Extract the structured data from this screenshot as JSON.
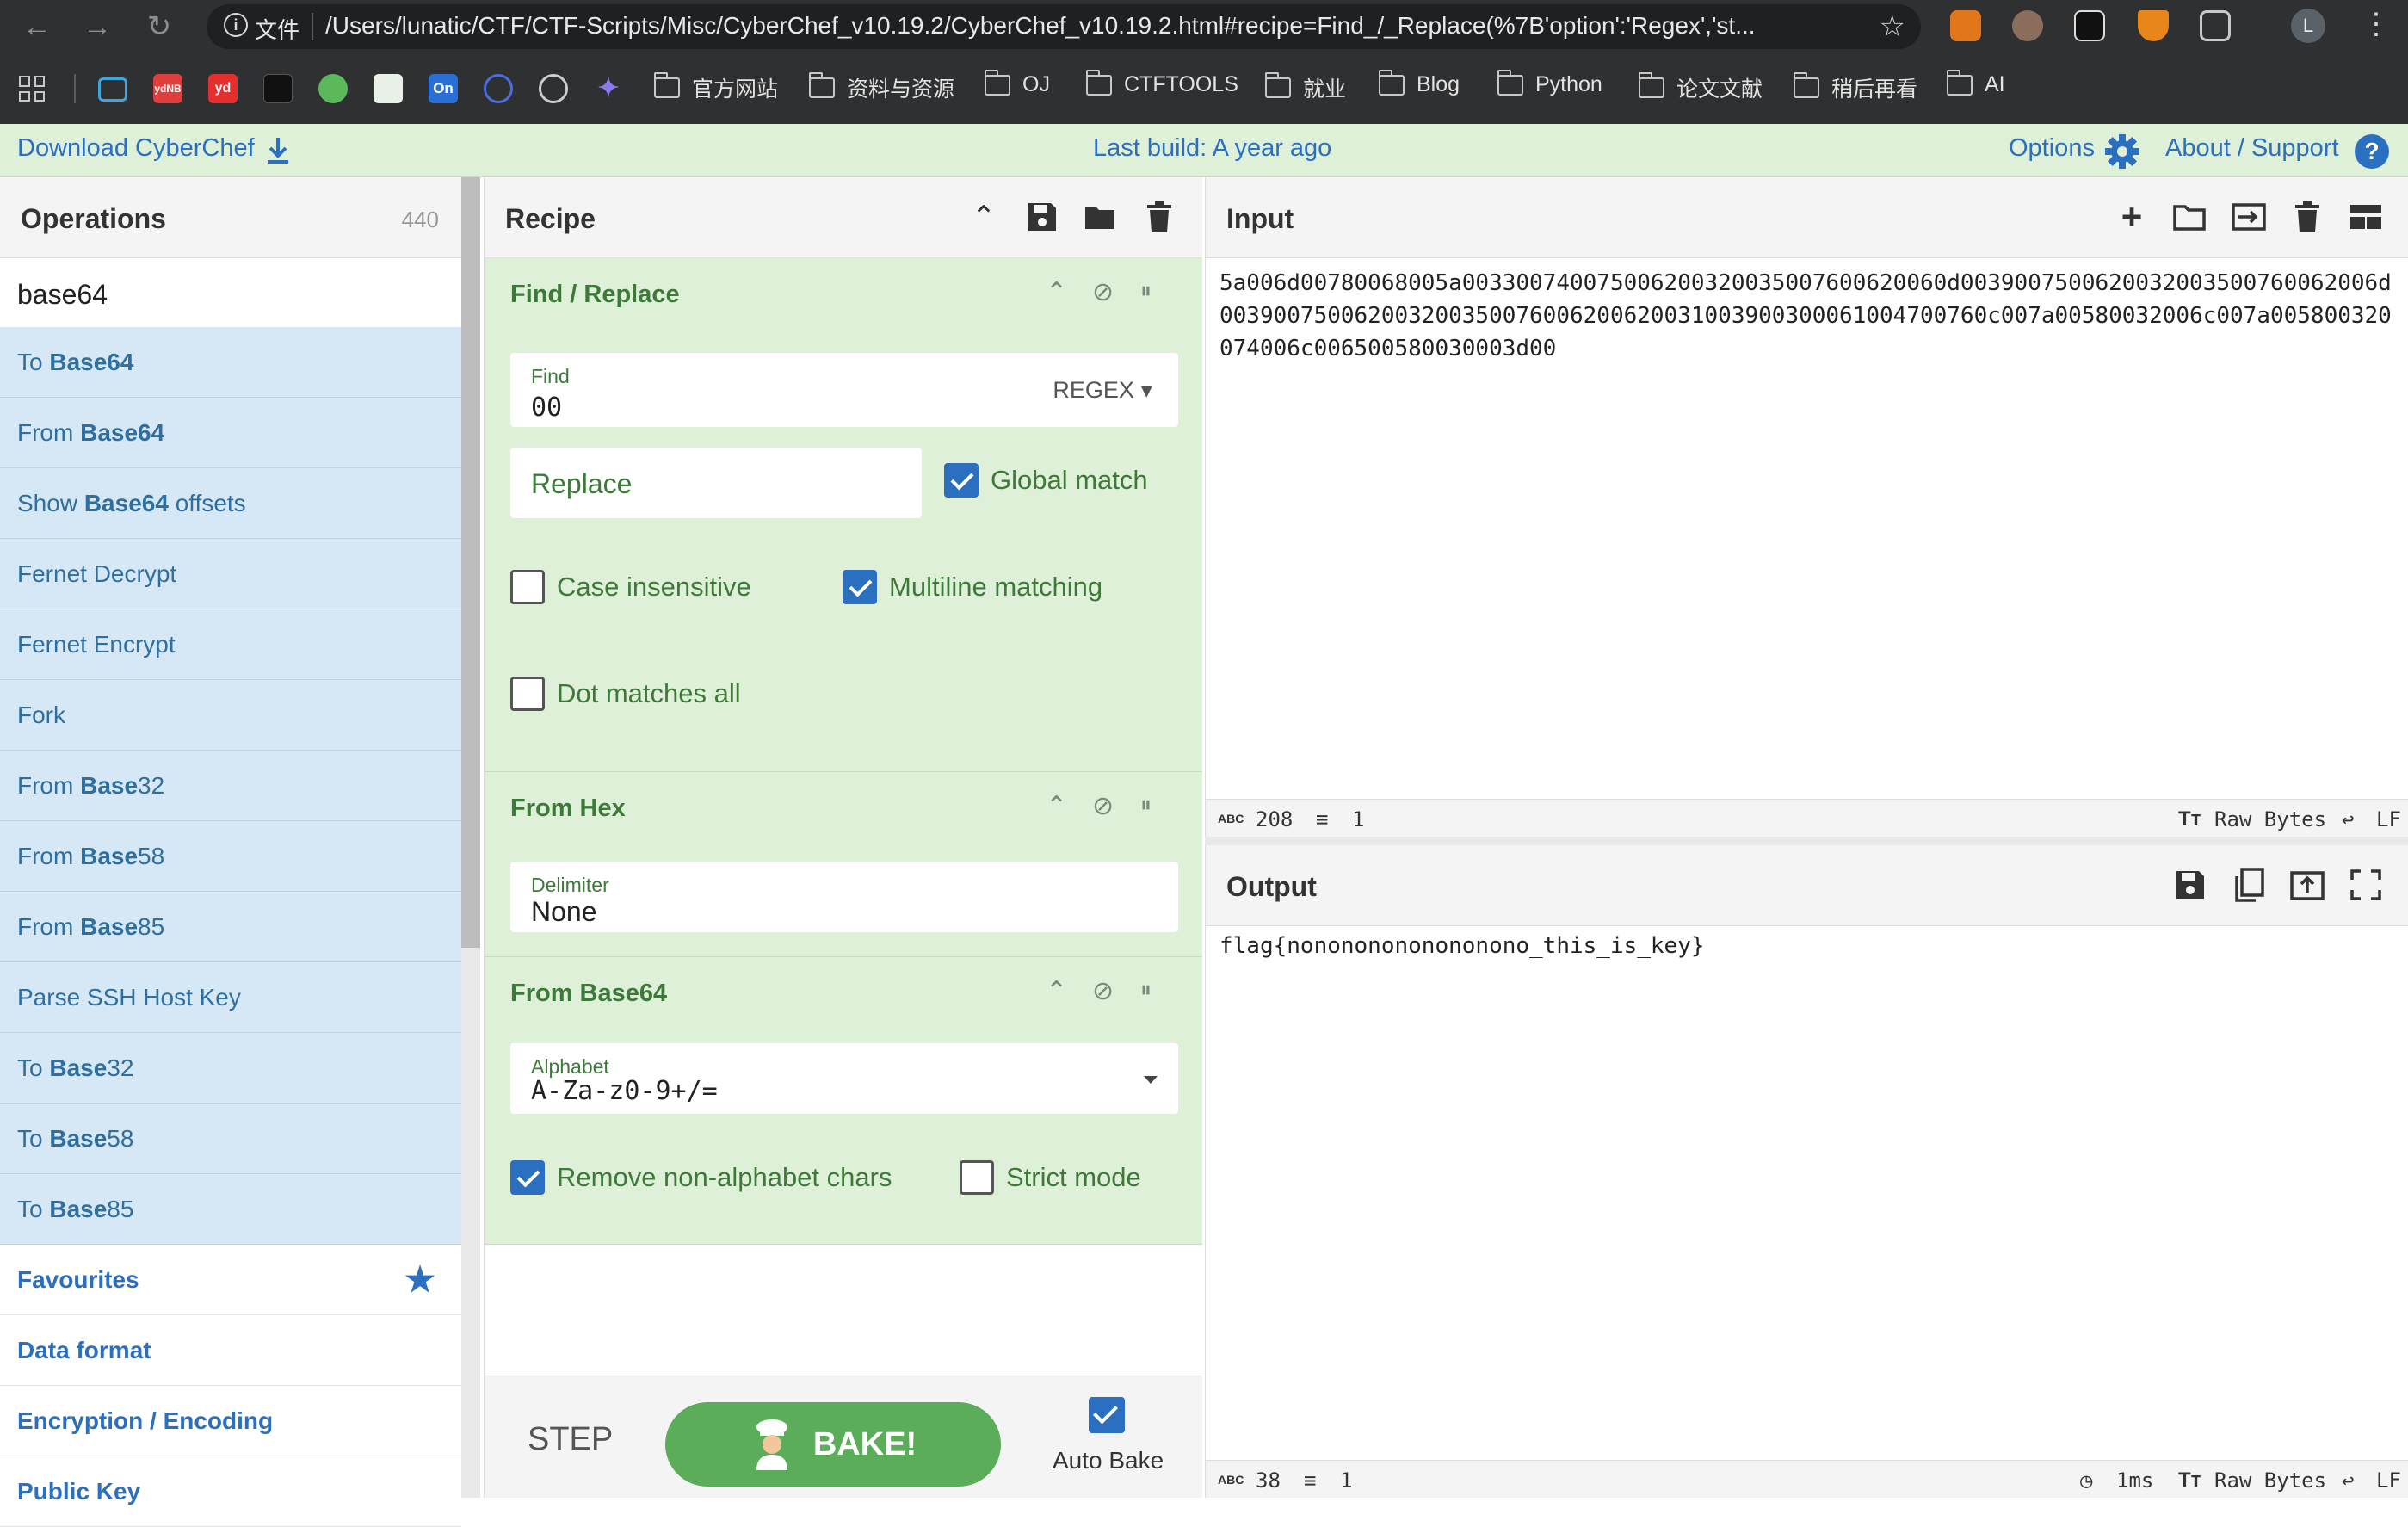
{
  "browser": {
    "file_label": "文件",
    "url": "/Users/lunatic/CTF/CTF-Scripts/Misc/CyberChef_v10.19.2/CyberChef_v10.19.2.html#recipe=Find_/_Replace(%7B'option':'Regex','st...",
    "profile_initial": "L",
    "bookmark_icons": [
      "ydNB",
      "yd",
      "On"
    ],
    "bookmark_folders": [
      "官方网站",
      "资料与资源",
      "OJ",
      "CTFTOOLS",
      "就业",
      "Blog",
      "Python",
      "论文文献",
      "稍后再看",
      "AI"
    ]
  },
  "banner": {
    "download": "Download CyberChef",
    "last_build": "Last build: A year ago",
    "options": "Options",
    "about": "About / Support"
  },
  "operations": {
    "title": "Operations",
    "count": "440",
    "search_value": "base64",
    "items": [
      {
        "pre": "To ",
        "bold": "Base64",
        "post": ""
      },
      {
        "pre": "From ",
        "bold": "Base64",
        "post": ""
      },
      {
        "pre": "Show ",
        "bold": "Base64",
        "post": " offsets"
      },
      {
        "pre": "Fernet Decrypt",
        "bold": "",
        "post": ""
      },
      {
        "pre": "Fernet Encrypt",
        "bold": "",
        "post": ""
      },
      {
        "pre": "Fork",
        "bold": "",
        "post": ""
      },
      {
        "pre": "From ",
        "bold": "Base",
        "post": "32"
      },
      {
        "pre": "From ",
        "bold": "Base",
        "post": "58"
      },
      {
        "pre": "From ",
        "bold": "Base",
        "post": "85"
      },
      {
        "pre": "Parse SSH Host Key",
        "bold": "",
        "post": ""
      },
      {
        "pre": "To ",
        "bold": "Base",
        "post": "32"
      },
      {
        "pre": "To ",
        "bold": "Base",
        "post": "58"
      },
      {
        "pre": "To ",
        "bold": "Base",
        "post": "85"
      }
    ],
    "categories": [
      "Favourites",
      "Data format",
      "Encryption / Encoding",
      "Public Key"
    ]
  },
  "recipe": {
    "title": "Recipe",
    "find_replace": {
      "name": "Find / Replace",
      "find_label": "Find",
      "find_value": "00",
      "find_mode": "REGEX",
      "replace_placeholder": "Replace",
      "global_match": "Global match",
      "case_insensitive": "Case insensitive",
      "multiline": "Multiline matching",
      "dot_all": "Dot matches all"
    },
    "from_hex": {
      "name": "From Hex",
      "delimiter_label": "Delimiter",
      "delimiter_value": "None"
    },
    "from_base64": {
      "name": "From Base64",
      "alphabet_label": "Alphabet",
      "alphabet_value": "A-Za-z0-9+/=",
      "remove_non_alpha": "Remove non-alphabet chars",
      "strict_mode": "Strict mode"
    },
    "step": "STEP",
    "bake": "BAKE!",
    "auto_bake": "Auto Bake"
  },
  "input": {
    "title": "Input",
    "text": "5a006d00780068005a003300740075006200320035007600620060d0039007500620032003500760062006d003900750062003200350076006200620031003900300061004700760c007a00580032006c007a005800320074006c006500580030003d00",
    "length": "208",
    "lines": "1",
    "encoding": "Raw Bytes",
    "eol": "LF"
  },
  "output": {
    "title": "Output",
    "text": "flag{nonononononononono_this_is_key}",
    "length": "38",
    "lines": "1",
    "time": "1ms",
    "encoding": "Raw Bytes",
    "eol": "LF"
  },
  "colors": {
    "accent_blue": "#2a6fc0",
    "recipe_green_bg": "#dff0d8",
    "recipe_green_text": "#3d7a3a",
    "ops_blue_bg": "#d6e8f5",
    "bake_green": "#5bad5a"
  }
}
